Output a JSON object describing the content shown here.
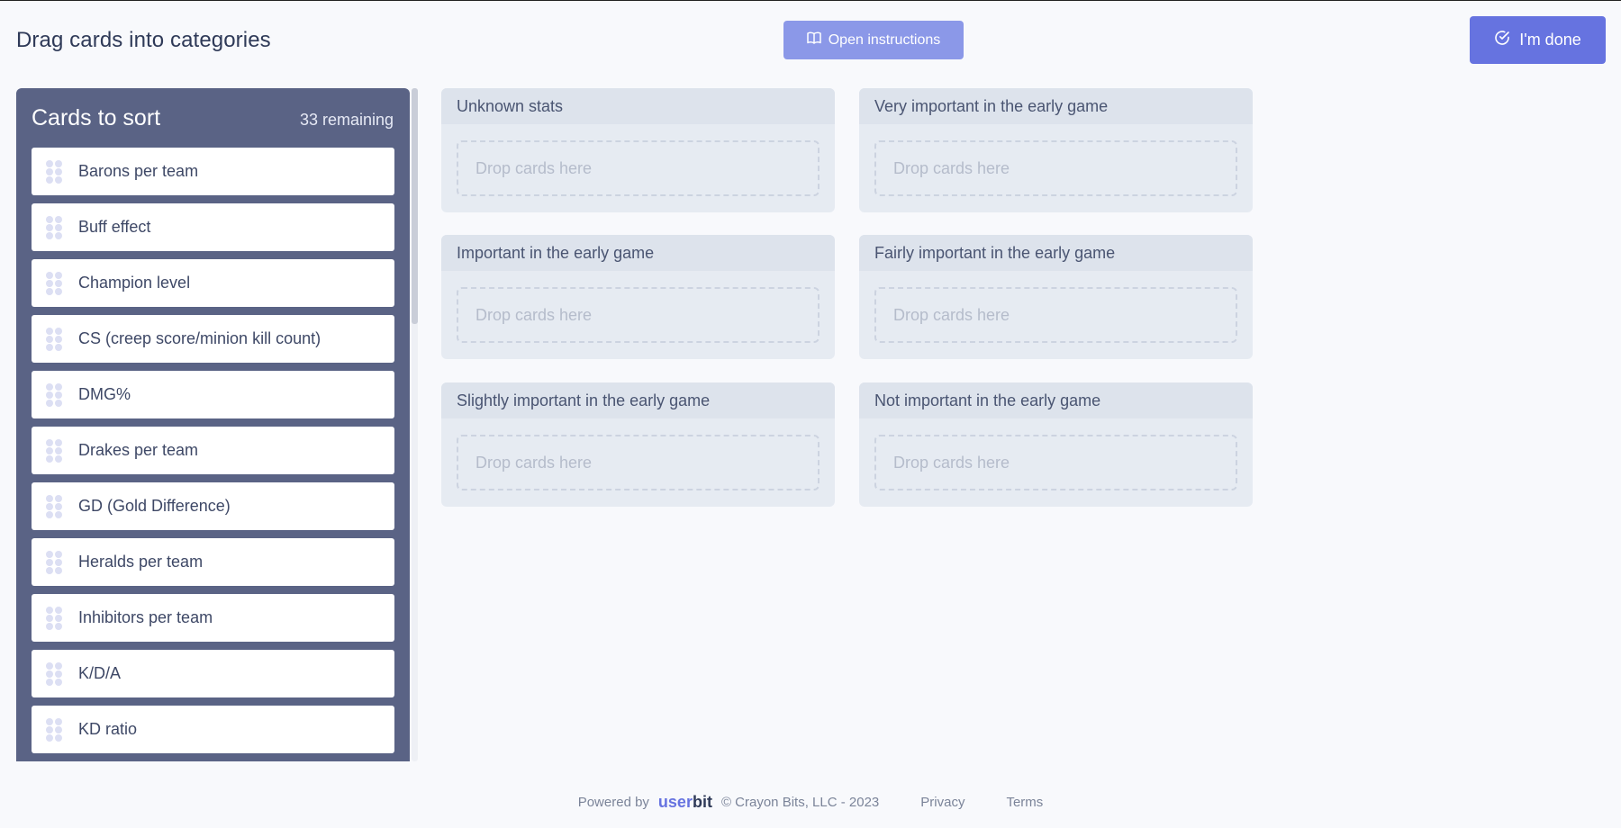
{
  "header": {
    "title": "Drag cards into categories",
    "instructions_label": "Open instructions",
    "done_label": "I'm done"
  },
  "sort_panel": {
    "title": "Cards to sort",
    "remaining": "33 remaining",
    "cards": [
      {
        "label": "Barons per team"
      },
      {
        "label": "Buff effect"
      },
      {
        "label": "Champion level"
      },
      {
        "label": "CS (creep score/minion kill count)"
      },
      {
        "label": "DMG%"
      },
      {
        "label": "Drakes per team"
      },
      {
        "label": "GD (Gold Difference)"
      },
      {
        "label": "Heralds per team"
      },
      {
        "label": "Inhibitors per team"
      },
      {
        "label": "K/D/A"
      },
      {
        "label": "KD ratio"
      }
    ]
  },
  "categories": [
    {
      "title": "Unknown stats",
      "drop_text": "Drop cards here"
    },
    {
      "title": "Very important in the early game",
      "drop_text": "Drop cards here"
    },
    {
      "title": "Important in the early game",
      "drop_text": "Drop cards here"
    },
    {
      "title": "Fairly important in the early game",
      "drop_text": "Drop cards here"
    },
    {
      "title": "Slightly important in the early game",
      "drop_text": "Drop cards here"
    },
    {
      "title": "Not important in the early game",
      "drop_text": "Drop cards here"
    }
  ],
  "footer": {
    "powered_by": "Powered by",
    "brand_part1": "user",
    "brand_part2": "bit",
    "copyright": "© Crayon Bits, LLC - 2023",
    "privacy": "Privacy",
    "terms": "Terms"
  },
  "colors": {
    "accent": "#6673e0",
    "accent_light": "#8b98e8",
    "panel": "#5a6385",
    "category_bg": "#e6ebf2"
  },
  "icons": {
    "instructions": "book-open-icon",
    "done": "check-circle-icon",
    "card_handle": "drag-handle-icon"
  }
}
